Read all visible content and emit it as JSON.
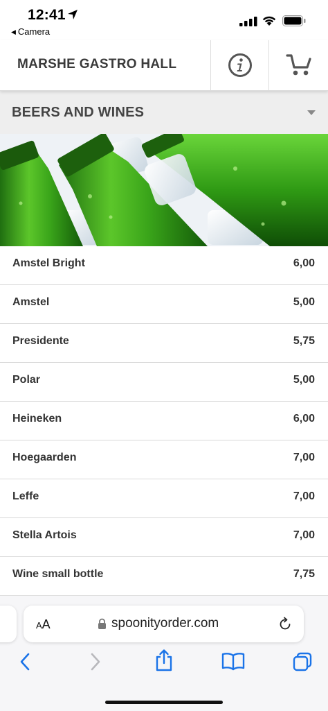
{
  "status_bar": {
    "time": "12:41",
    "back_app_label": "Camera"
  },
  "header": {
    "title": "MARSHE GASTRO HALL",
    "info_icon": "info-icon",
    "cart_icon": "cart-icon"
  },
  "category": {
    "title": "BEERS AND WINES"
  },
  "menu": {
    "items": [
      {
        "name": "Amstel Bright",
        "price": "6,00"
      },
      {
        "name": "Amstel",
        "price": "5,00"
      },
      {
        "name": "Presidente",
        "price": "5,75"
      },
      {
        "name": "Polar",
        "price": "5,00"
      },
      {
        "name": "Heineken",
        "price": "6,00"
      },
      {
        "name": "Hoegaarden",
        "price": "7,00"
      },
      {
        "name": "Leffe",
        "price": "7,00"
      },
      {
        "name": "Stella Artois",
        "price": "7,00"
      },
      {
        "name": "Wine small bottle",
        "price": "7,75"
      }
    ]
  },
  "browser": {
    "text_size_label_small": "A",
    "text_size_label_large": "A",
    "url": "spoonityorder.com"
  },
  "colors": {
    "accent_ios": "#1a73e8",
    "header_text": "#3a3a3a",
    "category_bg": "#eeeeee"
  }
}
